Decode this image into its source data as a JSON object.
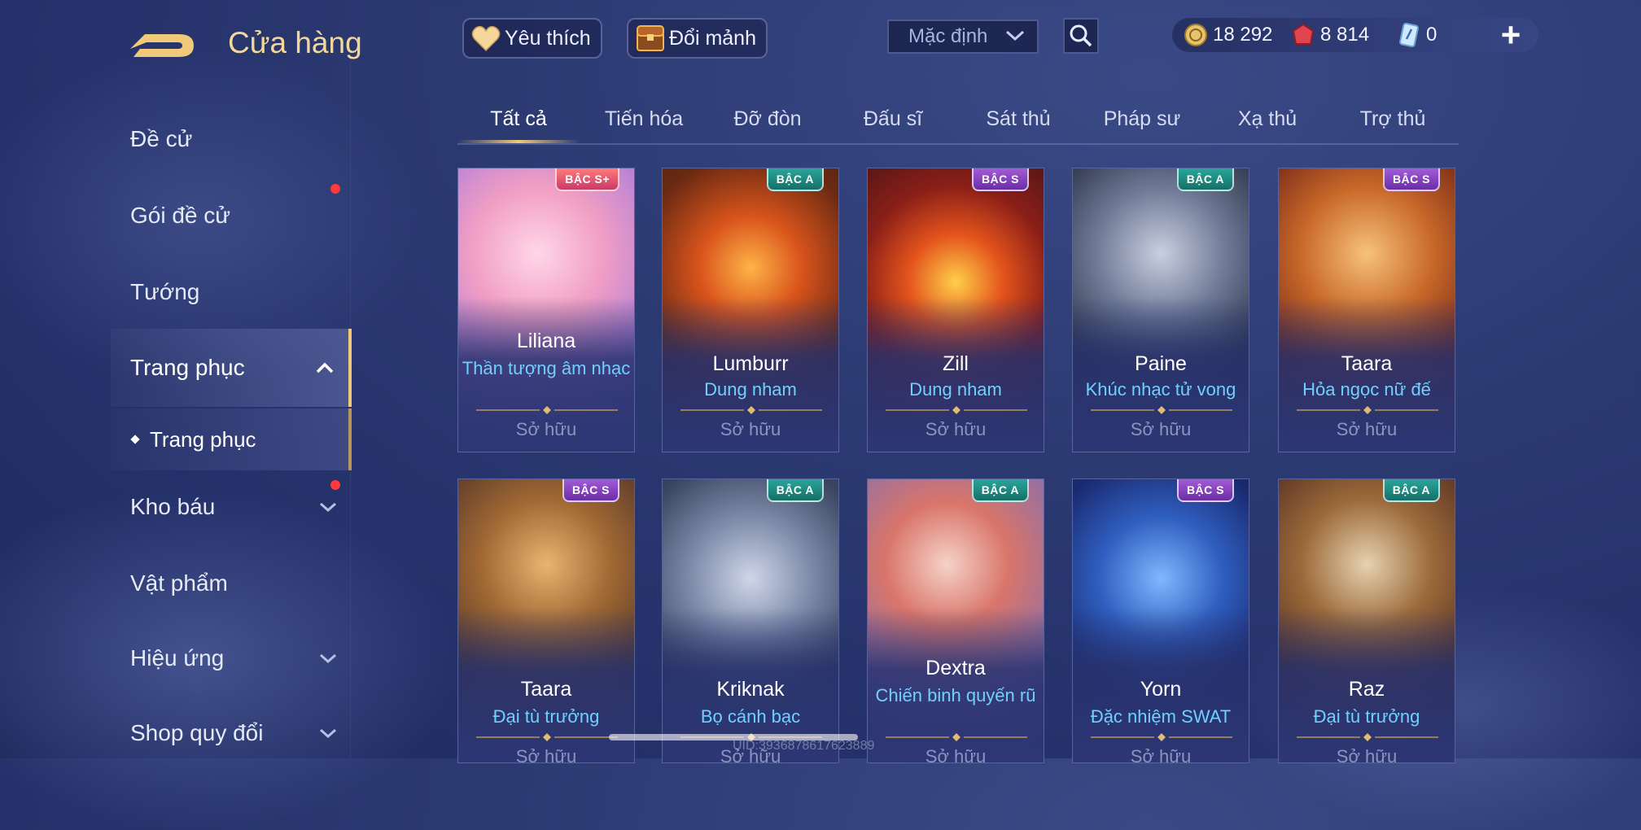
{
  "header": {
    "title": "Cửa hàng",
    "favorite_label": "Yêu thích",
    "exchange_label": "Đổi mảnh",
    "sort_value": "Mặc định"
  },
  "currency": {
    "gold": "18 292",
    "vouchers": "8 814",
    "tickets": "0"
  },
  "sidebar": {
    "items": [
      {
        "label": "Đề cử"
      },
      {
        "label": "Gói đề cử"
      },
      {
        "label": "Tướng"
      },
      {
        "label": "Trang phục"
      },
      {
        "label": "Kho báu"
      },
      {
        "label": "Vật phẩm"
      },
      {
        "label": "Hiệu ứng"
      },
      {
        "label": "Shop quy đổi"
      }
    ],
    "sub_item": "Trang phục"
  },
  "tabs": [
    "Tất cả",
    "Tiến hóa",
    "Đỡ đòn",
    "Đấu sĩ",
    "Sát thủ",
    "Pháp sư",
    "Xạ thủ",
    "Trợ thủ"
  ],
  "cards": [
    {
      "hero": "Liliana",
      "skin": "Thần tượng âm nhạc",
      "tier": "BẬC S+",
      "status": "Sở hữu"
    },
    {
      "hero": "Lumburr",
      "skin": "Dung nham",
      "tier": "BẬC A",
      "status": "Sở hữu"
    },
    {
      "hero": "Zill",
      "skin": "Dung nham",
      "tier": "BẬC S",
      "status": "Sở hữu"
    },
    {
      "hero": "Paine",
      "skin": "Khúc nhạc tử vong",
      "tier": "BẬC A",
      "status": "Sở hữu"
    },
    {
      "hero": "Taara",
      "skin": "Hỏa ngọc nữ đế",
      "tier": "BẬC S",
      "status": "Sở hữu"
    },
    {
      "hero": "Taara",
      "skin": "Đại tù trưởng",
      "tier": "BẬC S",
      "status": "Sở hữu"
    },
    {
      "hero": "Kriknak",
      "skin": "Bọ cánh bạc",
      "tier": "BẬC A",
      "status": "Sở hữu"
    },
    {
      "hero": "Dextra",
      "skin": "Chiến binh quyến rũ",
      "tier": "BẬC A",
      "status": "Sở hữu"
    },
    {
      "hero": "Yorn",
      "skin": "Đặc nhiệm SWAT",
      "tier": "BẬC S",
      "status": "Sở hữu"
    },
    {
      "hero": "Raz",
      "skin": "Đại tù trưởng",
      "tier": "BẬC A",
      "status": "Sở hữu"
    }
  ],
  "colors": {
    "accent_gold": "#f0c979",
    "skin_text": "#6fd0ff",
    "tier_a": "#1f8f86",
    "tier_s": "#8a45c2",
    "notification": "#ff3a3a"
  },
  "footer": {
    "uid": "UID:3936878617623889"
  }
}
